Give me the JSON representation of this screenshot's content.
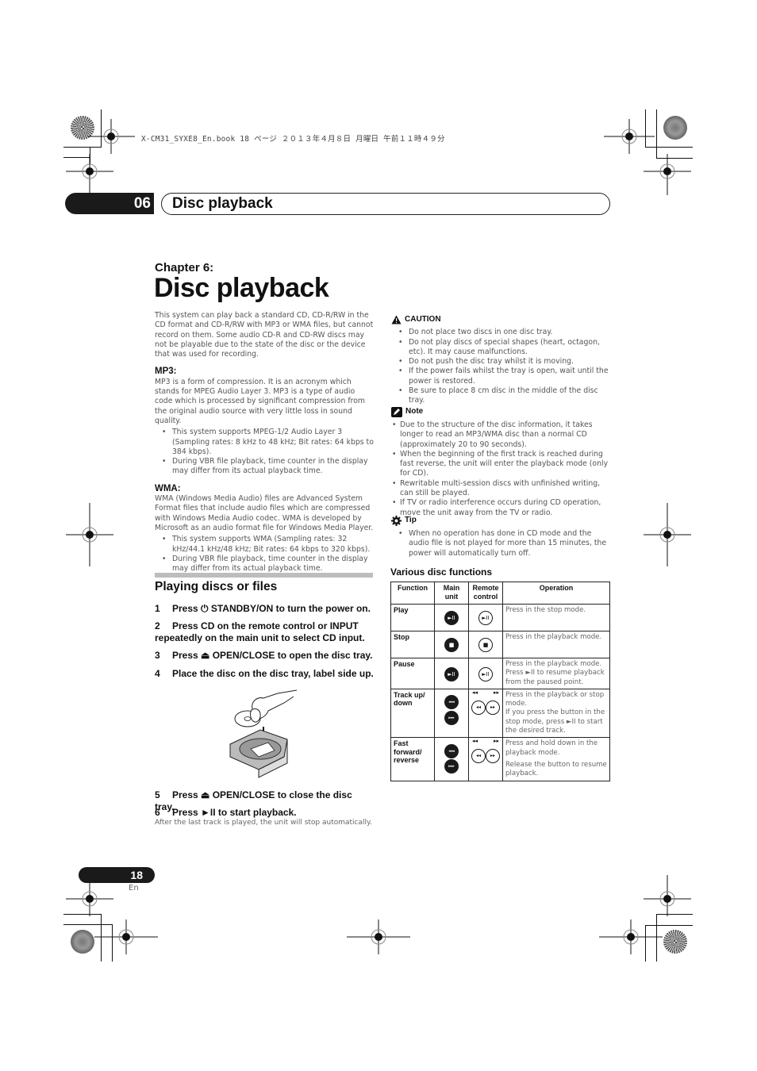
{
  "print_header": {
    "text": "X-CM31_SYXE8_En.book  18 ページ  ２０１３年４月８日  月曜日  午前１１時４９分"
  },
  "chapter_bar": {
    "number": "06",
    "title": "Disc playback"
  },
  "chapter_label": "Chapter 6:",
  "main_title": "Disc playback",
  "intro": "This system can play back a standard CD, CD-R/RW in the CD format and CD-R/RW with MP3 or WMA files, but cannot record on them. Some audio CD-R and CD-RW discs may not be playable due to the state of the disc or the device that was used for recording.",
  "mp3": {
    "heading": "MP3:",
    "text": "MP3 is a form of compression. It is an acronym which stands for MPEG Audio Layer 3. MP3 is a type of audio code which is processed by significant compression from the original audio source with very little loss in sound quality.",
    "bullets": [
      "This system supports MPEG-1/2 Audio Layer 3 (Sampling rates: 8 kHz to 48 kHz; Bit rates: 64 kbps to 384 kbps).",
      "During VBR file playback, time counter in the display may differ from its actual playback time."
    ]
  },
  "wma": {
    "heading": "WMA:",
    "text": "WMA (Windows Media Audio) files are Advanced System Format files that include audio files which are compressed with Windows Media Audio codec. WMA is developed by Microsoft as an audio format file for Windows Media Player.",
    "bullets": [
      "This system supports WMA (Sampling rates: 32 kHz/44.1 kHz/48 kHz; Bit rates: 64 kbps to 320 kbps).",
      "During VBR file playback, time counter in the display may differ from its actual playback time."
    ]
  },
  "playing": {
    "heading": "Playing discs or files",
    "steps": [
      {
        "n": "1",
        "text": "Press ⏻ STANDBY/ON to turn the power on."
      },
      {
        "n": "2",
        "text": "Press CD on the remote control or INPUT repeatedly on the main unit to select CD input."
      },
      {
        "n": "3",
        "text": "Press ⏏ OPEN/CLOSE to open the disc tray."
      },
      {
        "n": "4",
        "text": "Place the disc on the disc tray, label side up."
      },
      {
        "n": "5",
        "text": "Press ⏏ OPEN/CLOSE to close the disc tray."
      },
      {
        "n": "6",
        "text": "Press ►II to start playback."
      }
    ],
    "after_note": "After the last track is played, the unit will stop automatically."
  },
  "caution": {
    "heading": "CAUTION",
    "bullets": [
      "Do not place two discs in one disc tray.",
      "Do not play discs of special shapes (heart, octagon, etc). It may cause malfunctions.",
      "Do not push the disc tray whilst it is moving.",
      "If the power fails whilst the tray is open, wait until the power is restored.",
      "Be sure to place 8 cm disc in the middle of the disc tray."
    ]
  },
  "note": {
    "heading": "Note",
    "bullets": [
      "Due to the structure of the disc information, it takes longer to read an MP3/WMA disc than a normal CD (approximately 20 to 90 seconds).",
      "When the beginning of the first track is reached during fast reverse, the unit will enter the playback mode (only for CD).",
      "Rewritable multi-session discs with unfinished writing, can still be played.",
      "If TV or radio interference occurs during CD operation, move the unit away from the TV or radio."
    ]
  },
  "tip": {
    "heading": "Tip",
    "bullets": [
      "When no operation has done in CD mode and the audio file is not played for more than 15 minutes, the power will automatically turn off."
    ]
  },
  "functions_table": {
    "heading": "Various disc functions",
    "columns": [
      "Function",
      "Main unit",
      "Remote control",
      "Operation"
    ],
    "rows": [
      {
        "function": "Play",
        "main_icon": "play-pause",
        "remote_icon": "play-pause",
        "operation": [
          "Press in the stop mode."
        ]
      },
      {
        "function": "Stop",
        "main_icon": "stop",
        "remote_icon": "stop",
        "operation": [
          "Press in the playback mode."
        ]
      },
      {
        "function": "Pause",
        "main_icon": "play-pause",
        "remote_icon": "play-pause",
        "operation": [
          "Press in the playback mode. Press ►II to resume playback from the paused point."
        ]
      },
      {
        "function": "Track up/ down",
        "main_icon": "prev-next",
        "remote_icon": "rewind-forward",
        "operation": [
          "Press in the playback or stop mode.",
          "If you press the button in the stop mode, press ►II to start the desired track."
        ]
      },
      {
        "function": "Fast forward/ reverse",
        "main_icon": "prev-next",
        "remote_icon": "rewind-forward",
        "operation": [
          "Press and hold down in the playback mode.",
          "Release the button to resume playback."
        ]
      }
    ],
    "remote_labels": {
      "left": "◂◂",
      "right": "▸▸"
    }
  },
  "footer": {
    "page_number": "18",
    "language": "En"
  }
}
